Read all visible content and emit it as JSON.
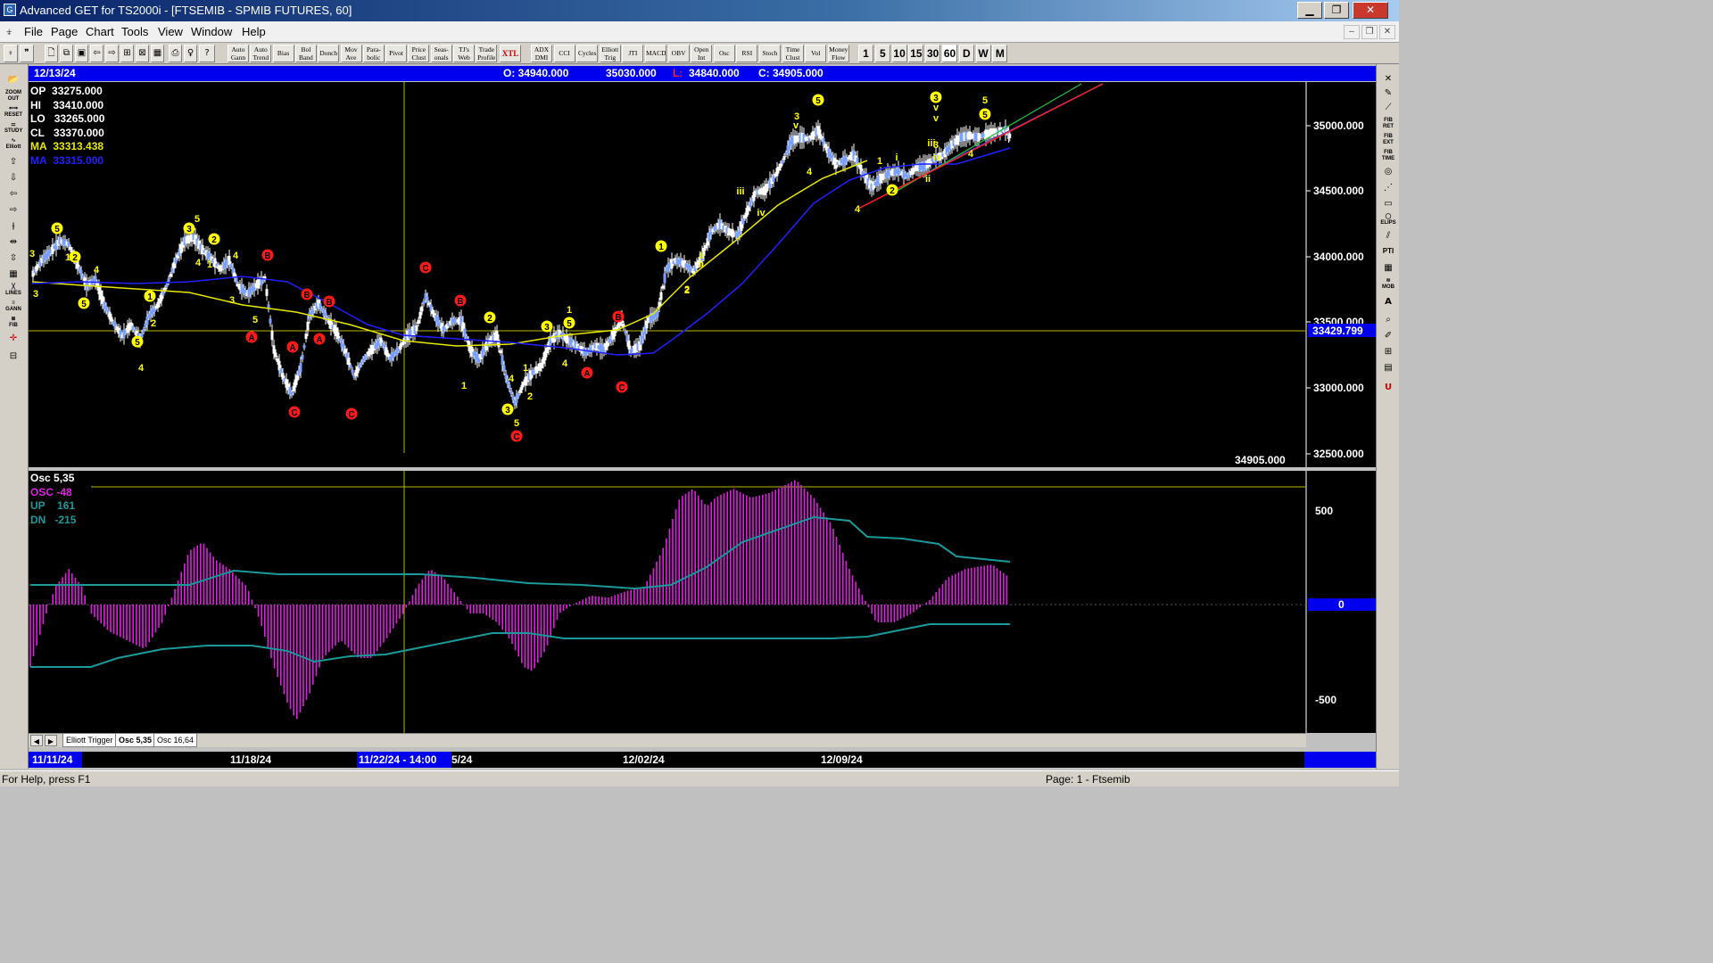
{
  "window": {
    "title": "Advanced GET for TS2000i - [FTSEMIB - SPMIB FUTURES, 60]",
    "minimize": "▁",
    "restore": "❐",
    "close": "✕"
  },
  "menu": {
    "items": [
      "File",
      "Page",
      "Chart",
      "Tools",
      "View",
      "Window",
      "Help"
    ],
    "mdi_minimize": "–",
    "mdi_restore": "❐",
    "mdi_close": "✕"
  },
  "toolbar": {
    "study_buttons": [
      [
        "Auto",
        "Gann"
      ],
      [
        "Auto",
        "Trend"
      ],
      [
        "Bias",
        ""
      ],
      [
        "Bol",
        "Band"
      ],
      [
        "Donch",
        ""
      ],
      [
        "Mov",
        "Ave"
      ],
      [
        "Para-",
        "bolic"
      ],
      [
        "Pivot",
        ""
      ],
      [
        "Price",
        "Clust"
      ],
      [
        "Seas-",
        "onals"
      ],
      [
        "TJ's",
        "Web"
      ],
      [
        "Trade",
        "Profile"
      ]
    ],
    "xtl": "XTL",
    "indicator_buttons": [
      [
        "ADX",
        "DMI"
      ],
      [
        "CCI",
        ""
      ],
      [
        "Cycles",
        ""
      ],
      [
        "Elliott",
        "Trig"
      ],
      [
        "JTI",
        ""
      ],
      [
        "MACD",
        ""
      ],
      [
        "OBV",
        ""
      ],
      [
        "Open",
        "Int"
      ],
      [
        "Osc",
        ""
      ],
      [
        "RSI",
        ""
      ],
      [
        "Stoch",
        ""
      ],
      [
        "Time",
        "Clust"
      ],
      [
        "Vol",
        ""
      ],
      [
        "Money",
        "Flow"
      ]
    ],
    "timeframes": [
      "1",
      "5",
      "10",
      "15",
      "30",
      "60",
      "D",
      "W",
      "M"
    ]
  },
  "header": {
    "date": "12/13/24",
    "open": "O: 34940.000",
    "high": "35030.000",
    "low_label": "L:",
    "low": "34840.000",
    "close": "C: 34905.000"
  },
  "price_info": {
    "op_label": "OP",
    "op": "33275.000",
    "hi_label": "HI",
    "hi": "33410.000",
    "lo_label": "LO",
    "lo": "33265.000",
    "cl_label": "CL",
    "cl": "33370.000",
    "ma1_label": "MA",
    "ma1": "33313.438",
    "ma2_label": "MA",
    "ma2": "33315.000"
  },
  "price_axis": {
    "ticks": [
      "35000.000",
      "34500.000",
      "34000.000",
      "33500.000",
      "33000.000",
      "32500.000"
    ],
    "crosshair_value": "33429.799",
    "last_value": "34905.000"
  },
  "osc_info": {
    "name": "Osc 5,35",
    "osc_label": "OSC",
    "osc": "-48",
    "up_label": "UP",
    "up": "161",
    "dn_label": "DN",
    "dn": "-215"
  },
  "osc_axis": {
    "ticks": [
      "500",
      "0",
      "-500"
    ]
  },
  "tabs": [
    "Elliott Trigger",
    "Osc 5,35",
    "Osc 16,64"
  ],
  "dates": {
    "labels": [
      "11/11/24",
      "11/18/24",
      "5/24",
      "12/02/24",
      "12/09/24"
    ],
    "crosshair_date": "11/22/24 - 14:00"
  },
  "status": {
    "left": "For Help, press F1",
    "right": "Page: 1 - Ftsemib"
  },
  "wave_labels": [
    [
      "5",
      "y"
    ],
    [
      "3",
      "y"
    ],
    [
      "1",
      "y"
    ],
    [
      "2",
      "y"
    ],
    [
      "4",
      "y"
    ],
    [
      "3",
      "y"
    ],
    [
      "5",
      "y"
    ],
    [
      "4",
      "y"
    ],
    [
      "5",
      "y"
    ],
    [
      "3",
      "y"
    ],
    [
      "4",
      "y"
    ],
    [
      "5",
      "y"
    ],
    [
      "1",
      "y"
    ],
    [
      "2",
      "y"
    ],
    [
      "4",
      "y"
    ],
    [
      "2",
      "y"
    ],
    [
      "1",
      "y"
    ],
    [
      "3",
      "y"
    ],
    [
      "5",
      "y"
    ],
    [
      "B",
      "r"
    ],
    [
      "A",
      "r"
    ],
    [
      "B",
      "r"
    ],
    [
      "A",
      "r"
    ],
    [
      "C",
      "r"
    ],
    [
      "C",
      "r"
    ],
    [
      "B",
      "r"
    ],
    [
      "C",
      "r"
    ],
    [
      "B",
      "r"
    ],
    [
      "A",
      "r"
    ],
    [
      "C",
      "r"
    ],
    [
      "B",
      "r"
    ],
    [
      "A",
      "r"
    ],
    [
      "C",
      "r"
    ],
    [
      "2",
      "y"
    ],
    [
      "1",
      "y"
    ],
    [
      "4",
      "y"
    ],
    [
      "3",
      "y"
    ],
    [
      "2",
      "y"
    ],
    [
      "1",
      "y"
    ],
    [
      "3",
      "y"
    ],
    [
      "5",
      "y"
    ],
    [
      "1",
      "y"
    ],
    [
      "5",
      "y"
    ],
    [
      "4",
      "y"
    ],
    [
      "2",
      "y"
    ],
    [
      "1",
      "y"
    ],
    [
      "2",
      "y"
    ],
    [
      "3",
      "y"
    ],
    [
      "3",
      "y"
    ],
    [
      "4",
      "y"
    ],
    [
      "4",
      "y"
    ],
    [
      "2",
      "y"
    ],
    [
      "1",
      "y"
    ],
    [
      "3",
      "y"
    ],
    [
      "5",
      "y"
    ],
    [
      "4",
      "y"
    ],
    [
      "5",
      "y"
    ],
    [
      "5",
      "y"
    ]
  ],
  "wave_roman": [
    "ii",
    "iii",
    "iv",
    "v",
    "v",
    "i",
    "ii",
    "iii",
    "iv",
    "v",
    "ii"
  ],
  "colors": {
    "header_blue": "#0000ee",
    "wave_yellow": "#ffff00",
    "wave_red": "#ff1a1a",
    "osc_magenta": "#e020e0",
    "band_teal": "#1a9a9a",
    "ma_yellow": "#e8e800",
    "ma_blue": "#2020ff"
  }
}
